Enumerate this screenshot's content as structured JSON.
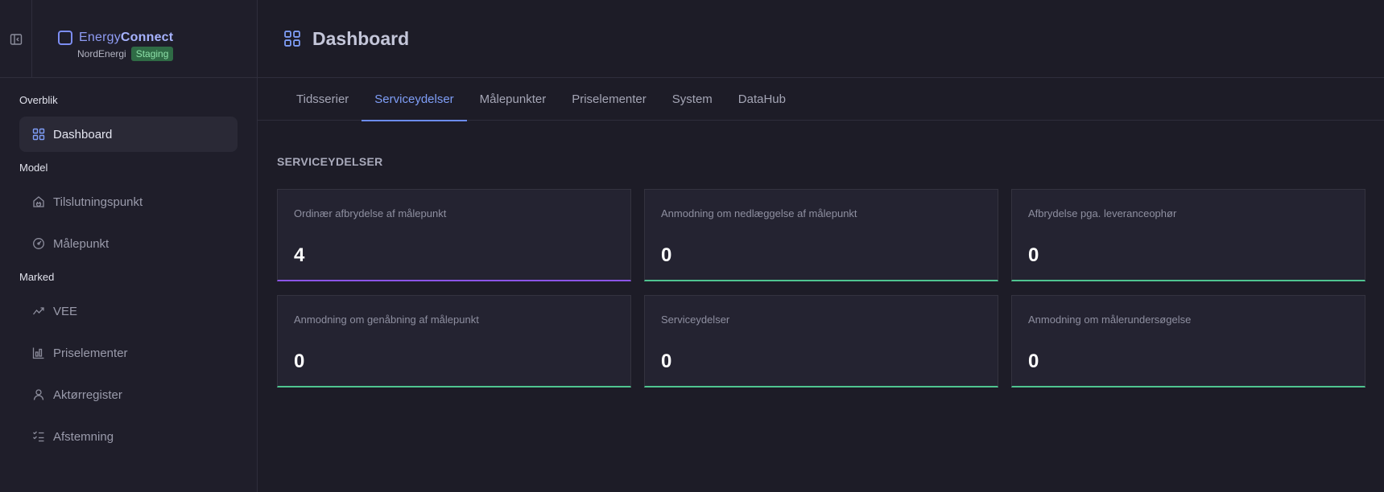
{
  "brand": {
    "name_a": "Energy",
    "name_b": "Connect",
    "org": "NordEnergi",
    "env_badge": "Staging"
  },
  "sidebar": {
    "sections": [
      {
        "label": "Overblik"
      },
      {
        "label": "Model"
      },
      {
        "label": "Marked"
      }
    ],
    "items": [
      {
        "label": "Dashboard",
        "icon": "grid-icon",
        "active": true
      },
      {
        "label": "Tilslutningspunkt",
        "icon": "house-plug-icon"
      },
      {
        "label": "Målepunkt",
        "icon": "gauge-icon"
      },
      {
        "label": "VEE",
        "icon": "trend-icon"
      },
      {
        "label": "Priselementer",
        "icon": "price-chart-icon"
      },
      {
        "label": "Aktørregister",
        "icon": "user-icon"
      },
      {
        "label": "Afstemning",
        "icon": "checklist-icon"
      }
    ]
  },
  "header": {
    "title": "Dashboard"
  },
  "tabs": [
    {
      "label": "Tidsserier"
    },
    {
      "label": "Serviceydelser",
      "active": true
    },
    {
      "label": "Målepunkter"
    },
    {
      "label": "Priselementer"
    },
    {
      "label": "System"
    },
    {
      "label": "DataHub"
    }
  ],
  "main": {
    "section_title": "SERVICEYDELSER",
    "cards": [
      {
        "label": "Ordinær afbrydelse af målepunkt",
        "value": "4",
        "accent": "#8b55e6"
      },
      {
        "label": "Anmodning om nedlæggelse af målepunkt",
        "value": "0",
        "accent": "#4fc490"
      },
      {
        "label": "Afbrydelse pga. leveranceophør",
        "value": "0",
        "accent": "#4fc490"
      },
      {
        "label": "Anmodning om genåbning af målepunkt",
        "value": "0",
        "accent": "#4fc490"
      },
      {
        "label": "Serviceydelser",
        "value": "0",
        "accent": "#4fc490"
      },
      {
        "label": "Anmodning om målerundersøgelse",
        "value": "0",
        "accent": "#4fc490"
      }
    ]
  }
}
